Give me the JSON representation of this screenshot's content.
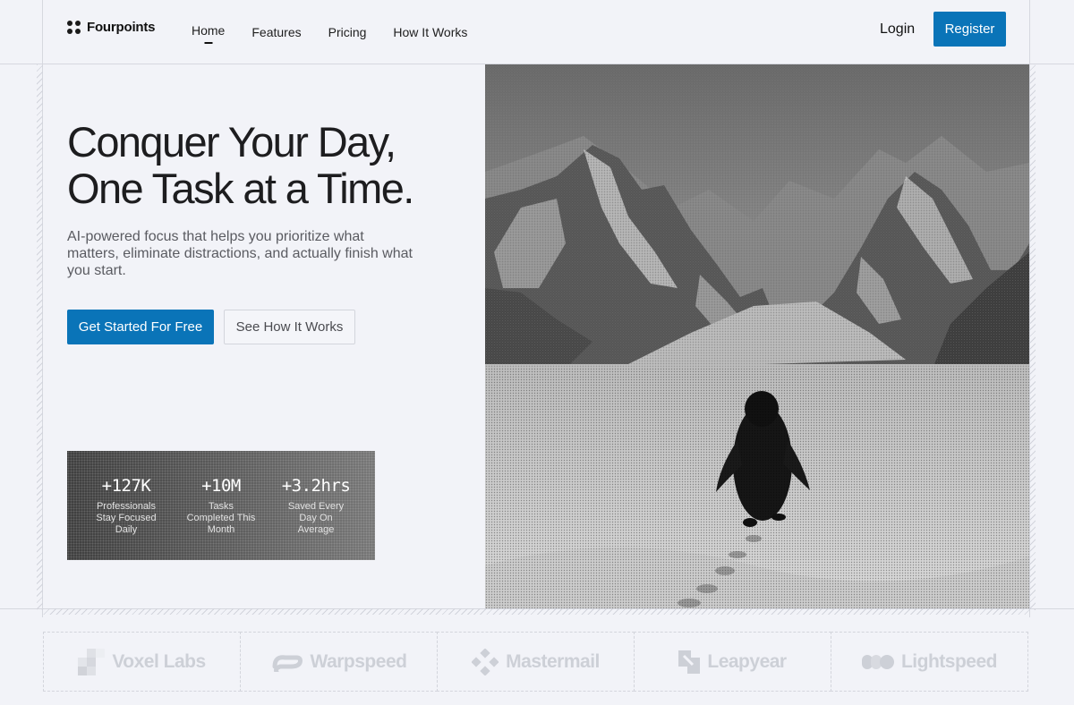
{
  "nav": {
    "brand": "Fourpoints",
    "links": [
      {
        "label": "Home",
        "active": true
      },
      {
        "label": "Features",
        "active": false
      },
      {
        "label": "Pricing",
        "active": false
      },
      {
        "label": "How It Works",
        "active": false
      }
    ],
    "login_label": "Login",
    "register_label": "Register"
  },
  "hero": {
    "title_line1": "Conquer Your Day,",
    "title_line2": "One Task at a Time.",
    "subtitle": "AI-powered focus that helps you prioritize what matters, eliminate distractions, and actually finish what you start.",
    "primary_cta": "Get Started For Free",
    "secondary_cta": "See How It Works"
  },
  "stats": [
    {
      "value": "+127K",
      "label": "Professionals Stay Focused Daily"
    },
    {
      "value": "+10M",
      "label": "Tasks Completed This Month"
    },
    {
      "value": "+3.2hrs",
      "label": "Saved Every Day On Average"
    }
  ],
  "partners": [
    {
      "name": "Voxel Labs",
      "icon": "voxel-logo-icon"
    },
    {
      "name": "Warpspeed",
      "icon": "warpspeed-logo-icon"
    },
    {
      "name": "Mastermail",
      "icon": "mastermail-logo-icon"
    },
    {
      "name": "Leapyear",
      "icon": "leapyear-logo-icon"
    },
    {
      "name": "Lightspeed",
      "icon": "lightspeed-logo-icon"
    }
  ],
  "colors": {
    "accent": "#0a74b8",
    "background": "#f2f3f8",
    "text": "#1d1d1f",
    "muted_text": "#5a5b61",
    "partner_logo": "#cdd0d7"
  }
}
